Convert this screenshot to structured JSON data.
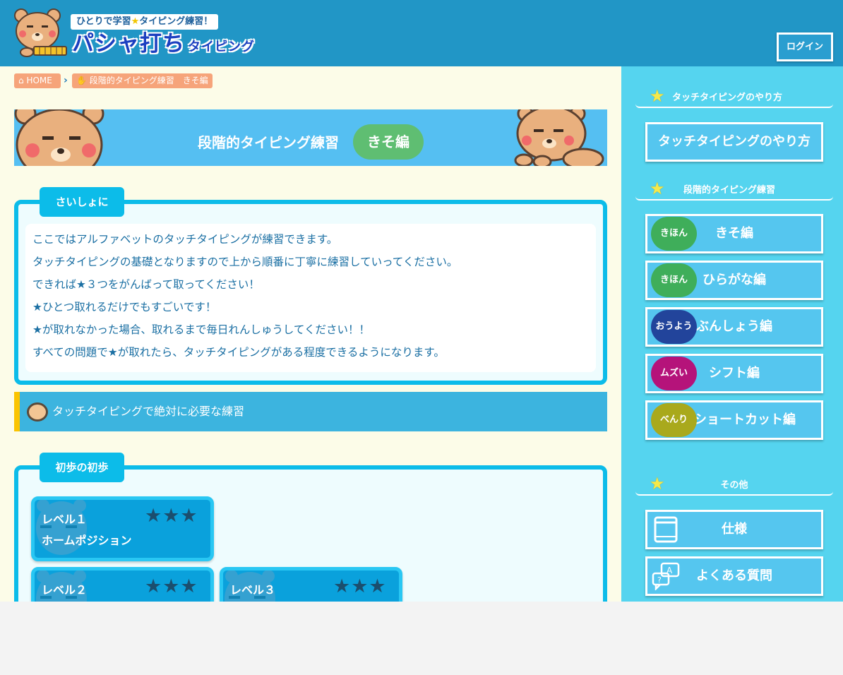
{
  "header": {
    "tagline_before": "ひとりで学習",
    "tagline_star": "★",
    "tagline_after": "タイピング練習！",
    "title": "パシャ打ち",
    "title_sub": "タイピング",
    "login_label": "ログイン"
  },
  "breadcrumb": {
    "home_label": "HOME",
    "current_label": "段階的タイピング練習　きそ編"
  },
  "hero": {
    "title": "段階的タイピング練習",
    "pill": "きそ編"
  },
  "intro": {
    "tab_label": "さいしょに",
    "lines": [
      "ここではアルファベットのタッチタイピングが練習できます。",
      "タッチタイピングの基礎となりますので上から順番に丁寧に練習していってください。",
      "できれば★３つをがんばって取ってください！",
      "★ひとつ取れるだけでもすごいです！",
      "★が取れなかった場合、取れるまで毎日れんしゅうしてください！！",
      "すべての問題で★が取れたら、タッチタイピングがある程度できるようになります。"
    ]
  },
  "section": {
    "title": "タッチタイピングで絶対に必要な練習"
  },
  "basics": {
    "tab_label": "初歩の初歩",
    "cards": [
      {
        "level": "レベル１",
        "name": "ホームポジション",
        "stars": "★★★"
      },
      {
        "level": "レベル２",
        "name": "",
        "stars": "★★★"
      },
      {
        "level": "レベル３",
        "name": "",
        "stars": "★★★"
      }
    ]
  },
  "sidebar": {
    "heading_touch": "タッチタイピングのやり方",
    "touch_button": "タッチタイピングのやり方",
    "heading_steps": "段階的タイピング練習",
    "steps": [
      {
        "badge": "きほん",
        "label": "きそ編",
        "color": "#3fae5a"
      },
      {
        "badge": "きほん",
        "label": "ひらがな編",
        "color": "#3fae5a"
      },
      {
        "badge": "おうよう",
        "label": "ぶんしょう編",
        "color": "#22449b"
      },
      {
        "badge": "ムズい",
        "label": "シフト編",
        "color": "#b5137a"
      },
      {
        "badge": "べんり",
        "label": "ショートカット編",
        "color": "#a9a91c"
      }
    ],
    "heading_other": "その他",
    "spec_button": "仕様",
    "faq_button": "よくある質問"
  },
  "colors": {
    "header_bg": "#2196c6",
    "sidebar_bg": "#55d4ef",
    "page_bg": "#fcfce8",
    "panel_border": "#0cbce9",
    "breadcrumb_bg": "#f6a47a",
    "text_blue": "#1a6fa3"
  }
}
